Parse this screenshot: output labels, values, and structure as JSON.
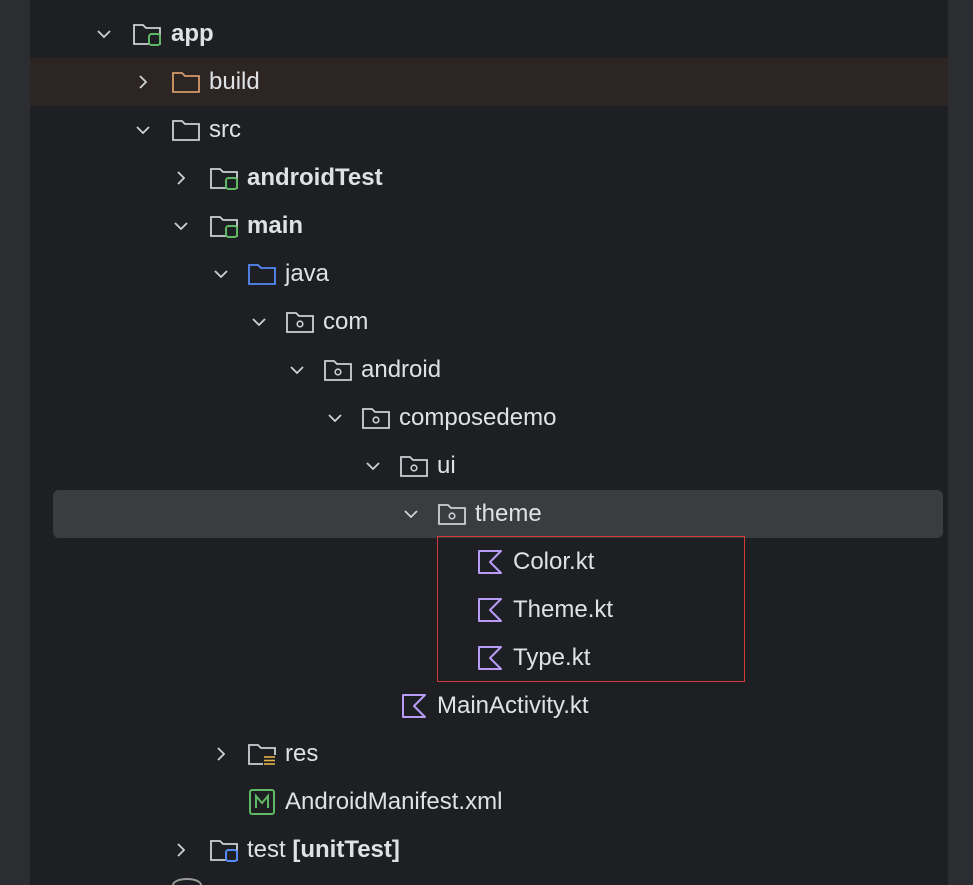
{
  "colors": {
    "background": "#1e1f22",
    "text": "#dfe1e5",
    "selected_row": "#3a3c40",
    "highlight_row": "#2c2523",
    "folder_gray": "#ced0d6",
    "folder_orange": "#d49a6a",
    "folder_blue": "#548af7",
    "module_badge_green": "#5fb865",
    "test_badge_blue": "#548af7",
    "kotlin_purple": "#b99bf8",
    "manifest_green": "#5fb865",
    "red_box": "#d5383d"
  },
  "tree": [
    {
      "label": "app",
      "bold": true,
      "chevron": "expanded",
      "icon": "module-folder-icon",
      "highlight": false,
      "selected": false
    },
    {
      "label": "build",
      "bold": false,
      "chevron": "collapsed",
      "icon": "excluded-folder-icon",
      "highlight": true,
      "selected": false
    },
    {
      "label": "src",
      "bold": false,
      "chevron": "expanded",
      "icon": "folder-icon",
      "highlight": false,
      "selected": false
    },
    {
      "label": "androidTest",
      "bold": true,
      "chevron": "collapsed",
      "icon": "module-folder-icon",
      "highlight": false,
      "selected": false
    },
    {
      "label": "main",
      "bold": true,
      "chevron": "expanded",
      "icon": "module-folder-icon",
      "highlight": false,
      "selected": false
    },
    {
      "label": "java",
      "bold": false,
      "chevron": "expanded",
      "icon": "source-folder-icon",
      "highlight": false,
      "selected": false
    },
    {
      "label": "com",
      "bold": false,
      "chevron": "expanded",
      "icon": "package-folder-icon",
      "highlight": false,
      "selected": false
    },
    {
      "label": "android",
      "bold": false,
      "chevron": "expanded",
      "icon": "package-folder-icon",
      "highlight": false,
      "selected": false
    },
    {
      "label": "composedemo",
      "bold": false,
      "chevron": "expanded",
      "icon": "package-folder-icon",
      "highlight": false,
      "selected": false
    },
    {
      "label": "ui",
      "bold": false,
      "chevron": "expanded",
      "icon": "package-folder-icon",
      "highlight": false,
      "selected": false
    },
    {
      "label": "theme",
      "bold": false,
      "chevron": "expanded",
      "icon": "package-folder-icon",
      "highlight": false,
      "selected": true
    },
    {
      "label": "Color.kt",
      "bold": false,
      "chevron": "none",
      "icon": "kotlin-file-icon",
      "highlight": false,
      "selected": false
    },
    {
      "label": "Theme.kt",
      "bold": false,
      "chevron": "none",
      "icon": "kotlin-file-icon",
      "highlight": false,
      "selected": false
    },
    {
      "label": "Type.kt",
      "bold": false,
      "chevron": "none",
      "icon": "kotlin-file-icon",
      "highlight": false,
      "selected": false
    },
    {
      "label": "MainActivity.kt",
      "bold": false,
      "chevron": "none",
      "icon": "kotlin-file-icon",
      "highlight": false,
      "selected": false
    },
    {
      "label": "res",
      "bold": false,
      "chevron": "collapsed",
      "icon": "resource-folder-icon",
      "highlight": false,
      "selected": false
    },
    {
      "label": "AndroidManifest.xml",
      "bold": false,
      "chevron": "none",
      "icon": "manifest-file-icon",
      "highlight": false,
      "selected": false
    },
    {
      "label": "test",
      "label_extra": "[unitTest]",
      "bold": false,
      "chevron": "collapsed",
      "icon": "test-module-folder-icon",
      "highlight": false,
      "selected": false
    }
  ]
}
